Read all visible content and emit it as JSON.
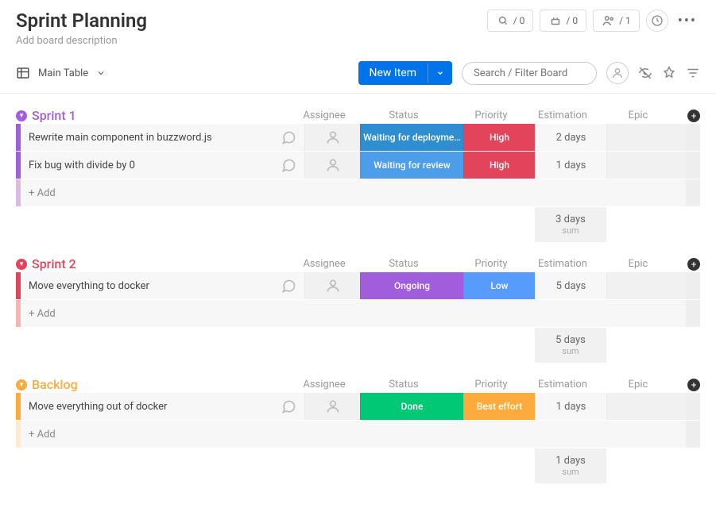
{
  "title": "Sprint Planning",
  "desc": "Add board description",
  "view": "Main Table",
  "badges": {
    "a": "/ 0",
    "b": "/ 0",
    "c": "/ 1"
  },
  "new_item": "New Item",
  "search_ph": "Search / Filter Board",
  "cols": {
    "assignee": "Assignee",
    "status": "Status",
    "priority": "Priority",
    "estimation": "Estimation",
    "epic": "Epic"
  },
  "add_label": "+ Add",
  "sum_label": "sum",
  "sections": [
    {
      "name": "Sprint 1",
      "sum": "3 days",
      "rows": [
        {
          "name": "Rewrite main component in buzzword.js",
          "status": "Waiting for deployme…",
          "status_c": "b-wfd",
          "prio": "High",
          "prio_c": "b-high",
          "est": "2 days"
        },
        {
          "name": "Fix bug with divide by 0",
          "status": "Waiting for review",
          "status_c": "b-wfr",
          "prio": "High",
          "prio_c": "b-high",
          "est": "1 days"
        }
      ]
    },
    {
      "name": "Sprint 2",
      "sum": "5 days",
      "rows": [
        {
          "name": "Move everything to docker",
          "status": "Ongoing",
          "status_c": "b-ong",
          "prio": "Low",
          "prio_c": "b-low",
          "est": "5 days"
        }
      ]
    },
    {
      "name": "Backlog",
      "sum": "1 days",
      "rows": [
        {
          "name": "Move everything out of docker",
          "status": "Done",
          "status_c": "b-done",
          "prio": "Best effort",
          "prio_c": "b-be",
          "est": "1 days"
        }
      ]
    }
  ]
}
